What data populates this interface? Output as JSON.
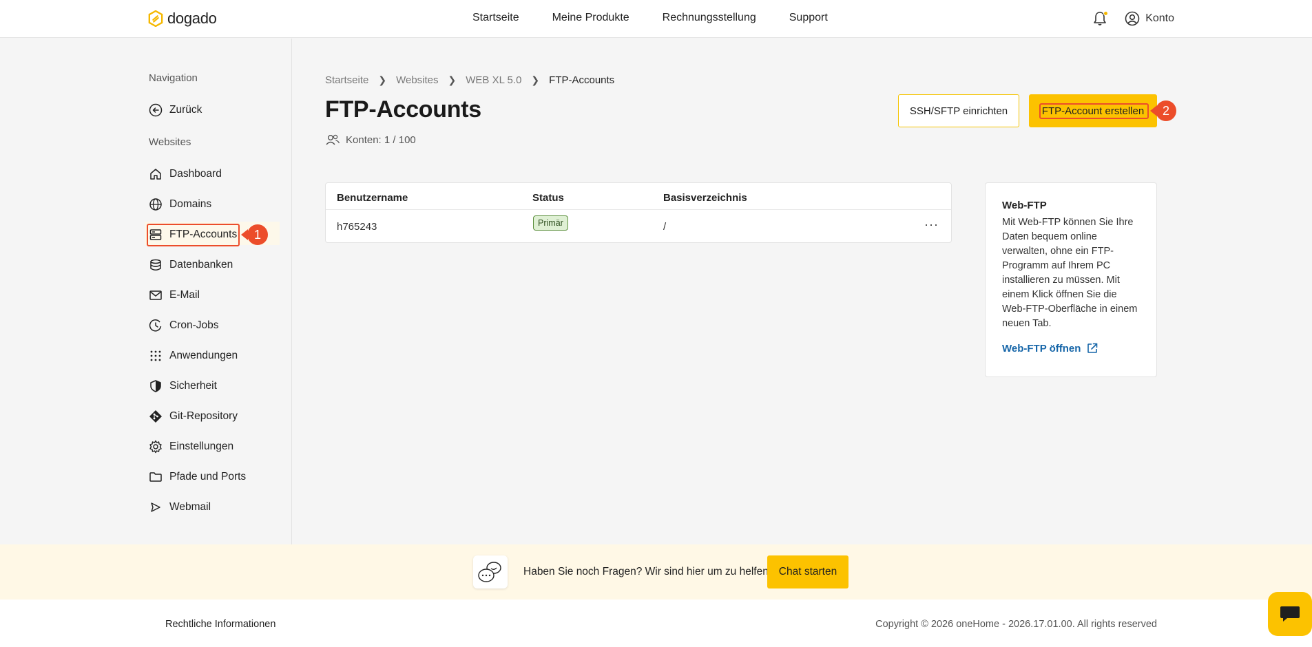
{
  "brand": {
    "name": "dogado"
  },
  "topnav": {
    "items": [
      "Startseite",
      "Meine Produkte",
      "Rechnungsstellung",
      "Support"
    ],
    "account_label": "Konto"
  },
  "sidebar": {
    "nav_heading": "Navigation",
    "back_label": "Zurück",
    "section_heading": "Websites",
    "items": [
      {
        "label": "Dashboard",
        "icon": "home-icon"
      },
      {
        "label": "Domains",
        "icon": "globe-icon"
      },
      {
        "label": "FTP-Accounts",
        "icon": "server-icon"
      },
      {
        "label": "Datenbanken",
        "icon": "database-icon"
      },
      {
        "label": "E-Mail",
        "icon": "mail-icon"
      },
      {
        "label": "Cron-Jobs",
        "icon": "clock-icon"
      },
      {
        "label": "Anwendungen",
        "icon": "grid-icon"
      },
      {
        "label": "Sicherheit",
        "icon": "shield-icon"
      },
      {
        "label": "Git-Repository",
        "icon": "git-icon"
      },
      {
        "label": "Einstellungen",
        "icon": "gear-icon"
      },
      {
        "label": "Pfade und Ports",
        "icon": "folder-icon"
      },
      {
        "label": "Webmail",
        "icon": "send-icon"
      }
    ]
  },
  "breadcrumb": [
    "Startseite",
    "Websites",
    "WEB XL 5.0",
    "FTP-Accounts"
  ],
  "page": {
    "title": "FTP-Accounts",
    "accounts_count": "Konten: 1 / 100",
    "btn_ssh": "SSH/SFTP einrichten",
    "btn_create": "FTP-Account erstellen"
  },
  "table": {
    "headers": [
      "Benutzername",
      "Status",
      "Basisverzeichnis"
    ],
    "rows": [
      {
        "username": "h765243",
        "status": "Primär",
        "directory": "/",
        "actions": "···"
      }
    ]
  },
  "info": {
    "title": "Web-FTP",
    "text": "Mit Web-FTP können Sie Ihre Daten bequem online verwalten, ohne ein FTP-Programm auf Ihrem PC installieren zu müssen. Mit einem Klick öffnen Sie die Web-FTP-Oberfläche in einem neuen Tab.",
    "link": "Web-FTP öffnen"
  },
  "help": {
    "text": "Haben Sie noch Fragen? Wir sind hier um zu helfen.",
    "button": "Chat starten"
  },
  "footer": {
    "left": "Rechtliche Informationen",
    "right": "Copyright © 2026 oneHome - 2026.17.01.00. All rights reserved"
  },
  "annotations": [
    "1",
    "2"
  ],
  "colors": {
    "accent": "#fcc200",
    "annotation": "#ec4d2a",
    "link": "#1565a8",
    "badge_bg": "#dff0d4"
  }
}
